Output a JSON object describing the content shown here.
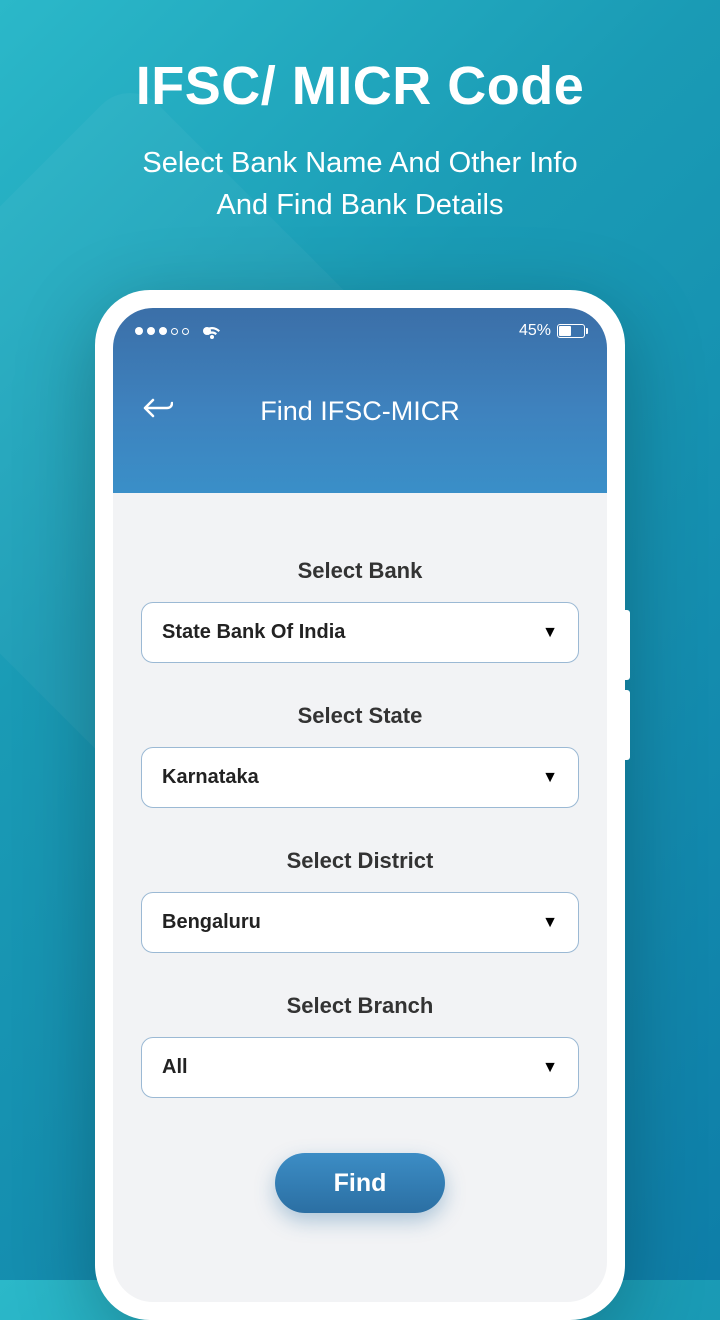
{
  "hero": {
    "title": "IFSC/ MICR Code",
    "subtitle_line1": "Select Bank Name And Other Info",
    "subtitle_line2": "And Find Bank Details"
  },
  "statusbar": {
    "battery_pct": "45%"
  },
  "appbar": {
    "title": "Find IFSC-MICR"
  },
  "form": {
    "bank": {
      "label": "Select Bank",
      "value": "State Bank Of India"
    },
    "state": {
      "label": "Select State",
      "value": "Karnataka"
    },
    "district": {
      "label": "Select District",
      "value": "Bengaluru"
    },
    "branch": {
      "label": "Select Branch",
      "value": "All"
    },
    "find_label": "Find"
  }
}
